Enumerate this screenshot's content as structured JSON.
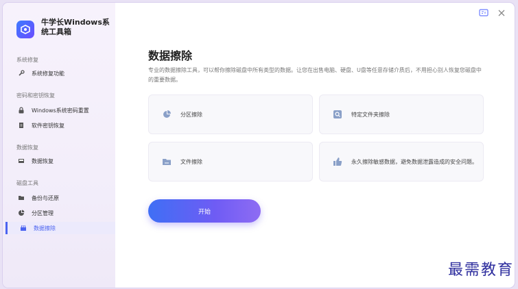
{
  "app": {
    "title": "牛学长Windows系统工具箱"
  },
  "sidebar": {
    "sections": [
      {
        "label": "系统修复",
        "items": [
          {
            "label": "系统修复功能",
            "icon": "wrench-icon"
          }
        ]
      },
      {
        "label": "密码和密钥恢复",
        "items": [
          {
            "label": "Windows系统密码重置",
            "icon": "lock-icon"
          },
          {
            "label": "软件密钥恢复",
            "icon": "document-icon"
          }
        ]
      },
      {
        "label": "数据恢复",
        "items": [
          {
            "label": "数据恢复",
            "icon": "disk-icon"
          }
        ]
      },
      {
        "label": "磁盘工具",
        "items": [
          {
            "label": "备份与还原",
            "icon": "folder-icon"
          },
          {
            "label": "分区管理",
            "icon": "pie-icon"
          },
          {
            "label": "数据擦除",
            "icon": "eraser-icon",
            "active": true
          }
        ]
      }
    ]
  },
  "main": {
    "title": "数据擦除",
    "description": "专业的数据擦除工具，可以帮你擦除磁盘中所有类型的数据。让您在出售电脑、硬盘、U盘等任意存储介质后，不用担心别人恢复您磁盘中的重要数据。",
    "cards": [
      {
        "label": "分区擦除",
        "icon": "partition-icon"
      },
      {
        "label": "特定文件夹擦除",
        "icon": "folder-search-icon"
      },
      {
        "label": "文件擦除",
        "icon": "file-folder-icon"
      },
      {
        "label": "永久擦除敏感数据，避免数据泄露造成的安全问题。",
        "icon": "thumbs-up-icon"
      }
    ],
    "start_button": "开始"
  },
  "watermark": "最需教育",
  "colors": {
    "accent": "#4b63f0",
    "button_start": "#3f6ff5",
    "button_end": "#8e6cf3"
  }
}
